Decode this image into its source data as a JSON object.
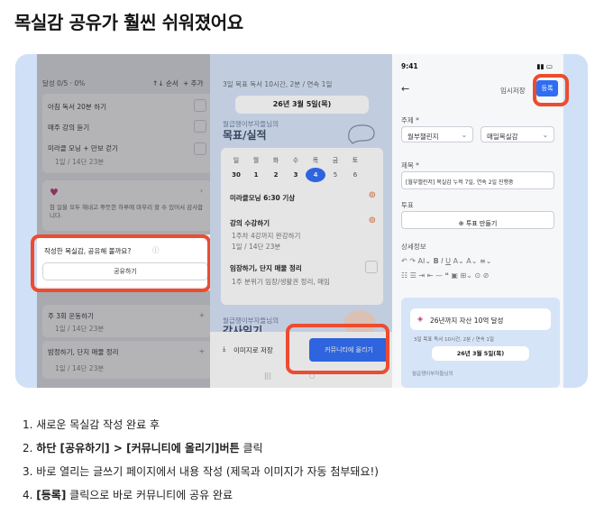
{
  "page": {
    "title": "목실감 공유가 훨씬 쉬워졌어요"
  },
  "screen1": {
    "header_progress": "달성 0/5 · 0%",
    "header_sort": "↑↓ 순서",
    "header_add": "+ 추가",
    "tasks": [
      {
        "label": "아침 독서 20분 하기"
      },
      {
        "label": "매주 강의 듣기"
      },
      {
        "label": "미라클 모닝 + 만보 걷기",
        "meta": "1일 / 14단 23분"
      }
    ],
    "gratitude_text": "참 일을 모두 해내고 뿌듯한 하루에 마무리 할 수 있어서 감사합니다.",
    "share_prompt": "작성한 목실감, 공유해 볼까요?",
    "share_button": "공유하기",
    "lower_tasks": [
      {
        "label": "주 3회 운동하기",
        "meta": "1일 / 14단 23분"
      },
      {
        "label": "밤정하기, 단지 매물 정리",
        "meta": "1일 / 14단 23분"
      }
    ]
  },
  "screen2": {
    "streak_text": "3일 목표 독서 10시간, 2분 / 연속 1일",
    "date_label": "26년 3월 5일(목)",
    "section_small": "월급쟁이부자들님의",
    "section_big": "목표/실적",
    "weekdays": [
      "일",
      "월",
      "화",
      "수",
      "목",
      "금",
      "토"
    ],
    "days": [
      "30",
      "1",
      "2",
      "3",
      "4",
      "5",
      "6"
    ],
    "items": [
      {
        "label": "미라클모닝 6:30 기상"
      },
      {
        "label": "강의 수강하기",
        "meta": "1주차 4강까지 완강하기",
        "meta2": "1일 / 14단 23분"
      },
      {
        "label": "임장하기, 단지 매물 정리",
        "meta": "1주 분위기 임장/생활권 정리, 매임"
      }
    ],
    "lower_small": "월급쟁이부자들님의",
    "lower_big": "감사일기",
    "save_image": "이미지로 저장",
    "upload_button": "커뮤니티에 올리기"
  },
  "screen3": {
    "time": "9:41",
    "temp_save": "임시저장",
    "register": "등록",
    "topic_label": "주제 *",
    "topic_value": "월부챌린지",
    "topic_value2": "매일목실감",
    "title_label": "제목 *",
    "title_value": "[월부챌린저] 목실감 누적 7일, 연속 2일 진행중",
    "vote_label": "투표",
    "vote_button": "투표 만들기",
    "body_label": "상세정보",
    "card_goal": "26년까지 자산 10억 달성",
    "card_meta": "3일 목표 독서 10시간, 2분 / 연속 1일",
    "card_date": "26년 3월 5일(목)",
    "card_small": "월급쟁이부자들님의"
  },
  "steps": [
    {
      "n": "1.",
      "pre": "새로운 목실감 작성 완료 후",
      "bold": "",
      "post": ""
    },
    {
      "n": "2.",
      "pre": "",
      "bold": "하단 [공유하기] > [커뮤니티에 올리기]버튼",
      "post": " 클릭"
    },
    {
      "n": "3.",
      "pre": "바로 열리는 글쓰기 페이지에서 내용 작성 (제목과 이미지가 자동 첨부돼요!)",
      "bold": "",
      "post": ""
    },
    {
      "n": "4.",
      "pre": "",
      "bold": "[등록]",
      "post": " 클릭으로 바로 커뮤니티에 공유 완료"
    }
  ],
  "colors": {
    "panel_bg": "#cfe0f7",
    "highlight": "#ec4c2f",
    "primary": "#2f6df5"
  }
}
